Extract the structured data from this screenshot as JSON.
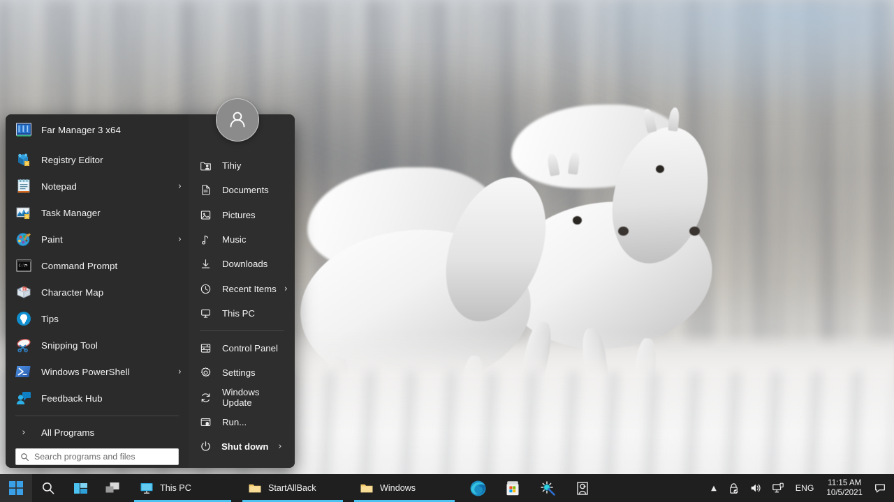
{
  "desktop": {
    "wallpaper_description": "two white horses galloping through snow, motion-blurred background",
    "colors": {
      "accent": "#4cc2f1",
      "menu_bg": "#2b2b2b",
      "taskbar_bg": "#1f1f1f"
    }
  },
  "start_menu": {
    "pinned": {
      "label": "Far Manager 3 x64",
      "icon": "far-manager-icon"
    },
    "apps": [
      {
        "label": "Registry Editor",
        "icon": "registry-editor-icon",
        "submenu": false
      },
      {
        "label": "Notepad",
        "icon": "notepad-icon",
        "submenu": true
      },
      {
        "label": "Task Manager",
        "icon": "task-manager-icon",
        "submenu": false
      },
      {
        "label": "Paint",
        "icon": "paint-icon",
        "submenu": true
      },
      {
        "label": "Command Prompt",
        "icon": "command-prompt-icon",
        "submenu": false
      },
      {
        "label": "Character Map",
        "icon": "character-map-icon",
        "submenu": false
      },
      {
        "label": "Tips",
        "icon": "tips-icon",
        "submenu": false
      },
      {
        "label": "Snipping Tool",
        "icon": "snipping-tool-icon",
        "submenu": false
      },
      {
        "label": "Windows PowerShell",
        "icon": "powershell-icon",
        "submenu": true
      },
      {
        "label": "Feedback Hub",
        "icon": "feedback-hub-icon",
        "submenu": false
      }
    ],
    "all_programs": {
      "label": "All Programs",
      "icon": "chevron-right-icon"
    },
    "search": {
      "placeholder": "Search programs and files",
      "value": "",
      "icon": "search-icon"
    },
    "user": {
      "name": "Tihiy",
      "avatar": "user-avatar-icon"
    },
    "places": [
      {
        "label": "Tihiy",
        "icon": "user-folder-icon",
        "submenu": false
      },
      {
        "label": "Documents",
        "icon": "document-icon",
        "submenu": false
      },
      {
        "label": "Pictures",
        "icon": "picture-icon",
        "submenu": false
      },
      {
        "label": "Music",
        "icon": "music-note-icon",
        "submenu": false
      },
      {
        "label": "Downloads",
        "icon": "download-arrow-icon",
        "submenu": false
      },
      {
        "label": "Recent Items",
        "icon": "clock-icon",
        "submenu": true
      },
      {
        "label": "This PC",
        "icon": "computer-icon",
        "submenu": false
      }
    ],
    "system": [
      {
        "label": "Control Panel",
        "icon": "control-panel-icon",
        "submenu": false
      },
      {
        "label": "Settings",
        "icon": "gear-icon",
        "submenu": false
      },
      {
        "label": "Windows Update",
        "icon": "refresh-icon",
        "submenu": false
      },
      {
        "label": "Run...",
        "icon": "run-icon",
        "submenu": false
      }
    ],
    "shutdown": {
      "label": "Shut down",
      "icon": "power-icon",
      "submenu": true
    }
  },
  "taskbar": {
    "start_button": {
      "icon": "windows-logo-icon"
    },
    "search_button": {
      "icon": "search-icon"
    },
    "task_view_button": {
      "icon": "task-view-icon"
    },
    "widgets_button": {
      "icon": "widgets-icon"
    },
    "windows": [
      {
        "label": "This PC",
        "icon": "this-pc-icon",
        "active": true
      },
      {
        "label": "StartAllBack",
        "icon": "folder-icon",
        "active": true
      },
      {
        "label": "Windows",
        "icon": "folder-icon",
        "active": true
      }
    ],
    "pinned": [
      {
        "label": "Microsoft Edge",
        "icon": "edge-icon"
      },
      {
        "label": "Microsoft Store",
        "icon": "store-icon"
      },
      {
        "label": "Process Hacker",
        "icon": "process-hacker-icon"
      },
      {
        "label": "Sysinternals",
        "icon": "sysinternals-icon"
      }
    ],
    "tray": {
      "chevron": {
        "icon": "chevron-up-icon"
      },
      "icons": [
        {
          "name": "security-icon"
        },
        {
          "name": "volume-icon"
        },
        {
          "name": "network-icon"
        }
      ],
      "language": "ENG",
      "clock": {
        "time": "11:15 AM",
        "date": "10/5/2021"
      },
      "notifications": {
        "icon": "chat-bubble-icon"
      }
    }
  }
}
